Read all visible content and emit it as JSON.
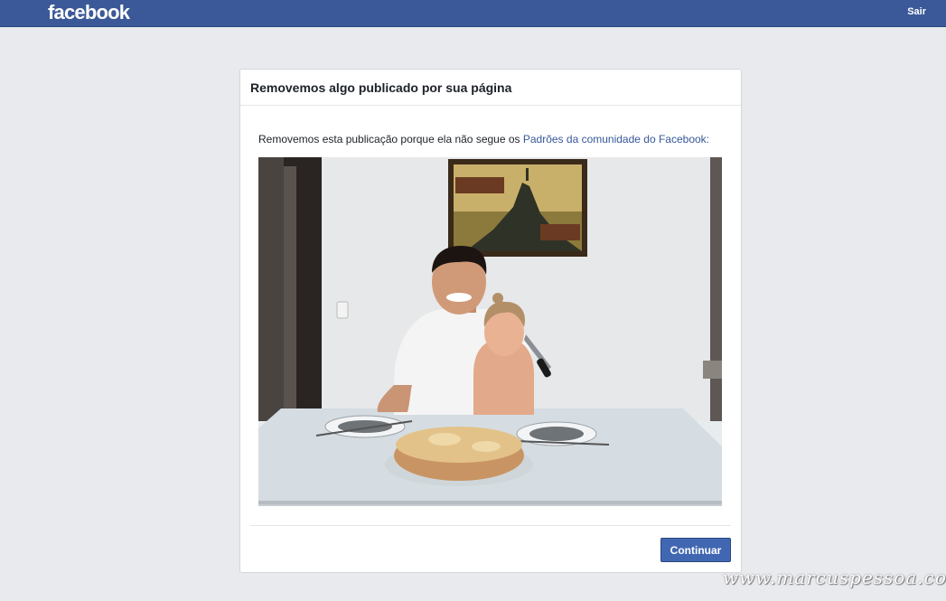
{
  "topbar": {
    "logo": "facebook",
    "logout_label": "Sair",
    "color": "#3b5998"
  },
  "dialog": {
    "title": "Removemos algo publicado por sua página",
    "message_prefix": "Removemos esta publicação porque ela não segue os ",
    "message_link": "Padrões da comunidade do Facebook:",
    "continue_label": "Continuar",
    "button_color": "#4267b2"
  },
  "watermark": "www.marcuspessoa.com"
}
